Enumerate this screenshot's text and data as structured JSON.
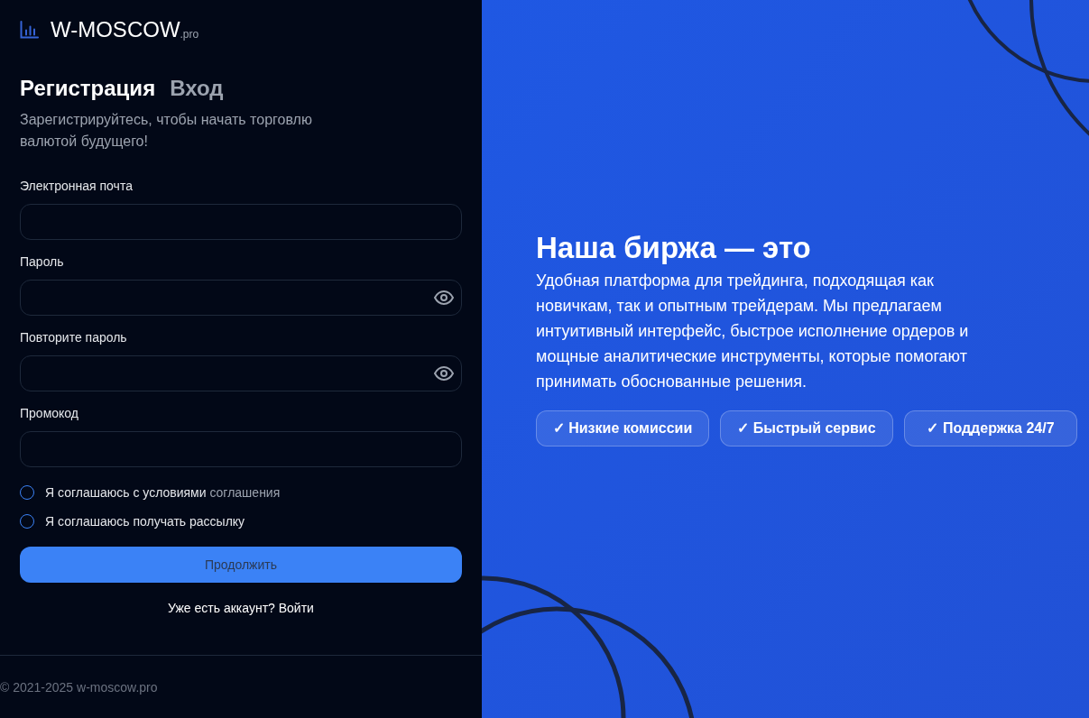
{
  "brand": {
    "name": "W-MOSCOW",
    "suffix": ".pro"
  },
  "tabs": [
    {
      "label": "Регистрация",
      "selected": true
    },
    {
      "label": "Вход",
      "selected": false
    }
  ],
  "subtitle": "Зарегистрируйтесь, чтобы начать торговлю валютой будущего!",
  "fields": [
    {
      "label": "Электронная почта",
      "kind": "email"
    },
    {
      "label": "Пароль",
      "kind": "password"
    },
    {
      "label": "Повторите пароль",
      "kind": "password"
    },
    {
      "label": "Промокод",
      "kind": "text"
    }
  ],
  "agreements": [
    {
      "text": "Я соглашаюсь с условиями",
      "link": "соглашения",
      "checked": false
    },
    {
      "text": "Я соглашаюсь получать рассылку",
      "checked": false
    }
  ],
  "submit": "Продолжить",
  "login_prompt": "Уже есть аккаунт? Войти",
  "footer": "© 2021-2025 w-moscow.pro",
  "promo": {
    "heading": "Наша биржа — это",
    "text": "Удобная платформа для трейдинга, подходящая как новичкам, так и опытным трейдерам. Мы предлагаем интуитивный интерфейс, быстрое исполнение ордеров и мощные аналитические инструменты, которые помогают принимать обоснованные решения.",
    "features": [
      "✓ Низкие комиссии",
      "✓ Быстрый сервис",
      "✓ Поддержка 24/7"
    ]
  }
}
